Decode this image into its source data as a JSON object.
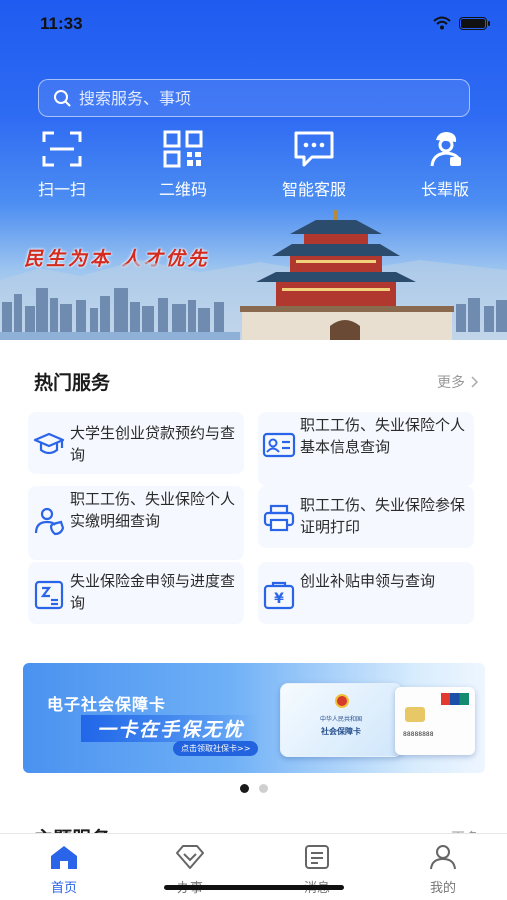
{
  "status_bar": {
    "time": "11:33"
  },
  "search": {
    "placeholder": "搜索服务、事项"
  },
  "quick_actions": [
    {
      "label": "扫一扫",
      "icon": "scan-icon"
    },
    {
      "label": "二维码",
      "icon": "qrcode-icon"
    },
    {
      "label": "智能客服",
      "icon": "chat-service-icon"
    },
    {
      "label": "长辈版",
      "icon": "elder-mode-icon"
    }
  ],
  "banner_slogan": "民生为本 人才优先",
  "hot_services": {
    "title": "热门服务",
    "more": "更多",
    "items": [
      {
        "label": "大学生创业贷款预约与查询",
        "icon": "graduation-cap-icon"
      },
      {
        "label": "职工工伤、失业保险个人基本信息查询",
        "icon": "id-card-icon"
      },
      {
        "label": "职工工伤、失业保险个人实缴明细查询",
        "icon": "person-shield-icon"
      },
      {
        "label": "职工工伤、失业保险参保证明打印",
        "icon": "printer-icon"
      },
      {
        "label": "失业保险金申领与进度查询",
        "icon": "document-check-icon"
      },
      {
        "label": "创业补贴申领与查询",
        "icon": "yuan-bag-icon"
      }
    ]
  },
  "promo_banner": {
    "title": "电子社会保障卡",
    "subtitle": "一卡在手保无忧",
    "cta": "点击领取社保卡>>",
    "card_header": "中华人民共和国",
    "card_title": "社会保障卡",
    "card_number": "88888888"
  },
  "carousel": {
    "total": 2,
    "active": 0
  },
  "topic_services": {
    "title": "主题服务",
    "more": "更多"
  },
  "tabs": [
    {
      "label": "首页",
      "icon": "home-icon",
      "active": true
    },
    {
      "label": "办事",
      "icon": "diamond-icon",
      "active": false
    },
    {
      "label": "消息",
      "icon": "message-icon",
      "active": false
    },
    {
      "label": "我的",
      "icon": "user-icon",
      "active": false
    }
  ],
  "colors": {
    "primary": "#2a64e8",
    "slogan": "#d52a1e"
  }
}
